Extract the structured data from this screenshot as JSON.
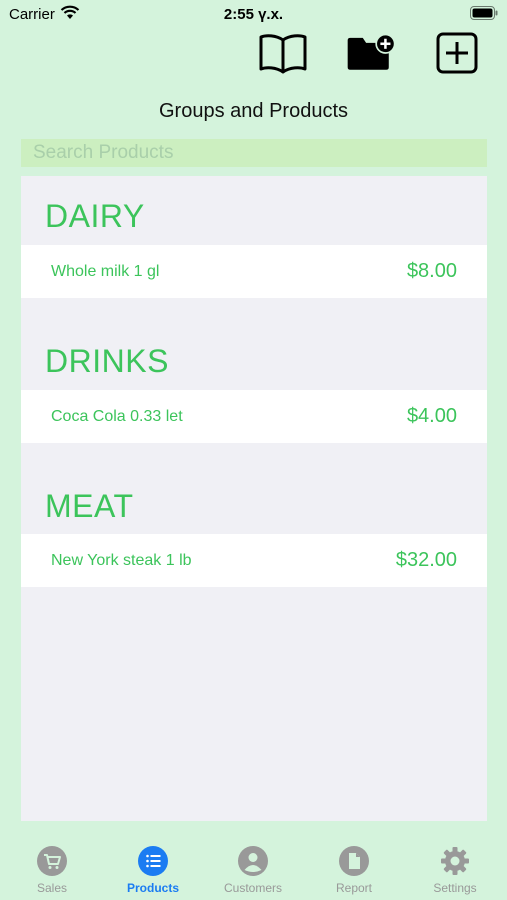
{
  "status_bar": {
    "carrier": "Carrier",
    "time": "2:55 ү.х."
  },
  "header": {
    "title": "Groups and Products"
  },
  "search": {
    "placeholder": "Search Products"
  },
  "groups": [
    {
      "name": "DAIRY",
      "products": [
        {
          "name": "Whole milk 1 gl",
          "price": "$8.00"
        }
      ]
    },
    {
      "name": "DRINKS",
      "products": [
        {
          "name": "Coca Cola 0.33 let",
          "price": "$4.00"
        }
      ]
    },
    {
      "name": "MEAT",
      "products": [
        {
          "name": "New York steak 1 lb",
          "price": "$32.00"
        }
      ]
    }
  ],
  "tabs": [
    {
      "label": "Sales",
      "icon": "cart-icon",
      "active": false
    },
    {
      "label": "Products",
      "icon": "list-icon",
      "active": true
    },
    {
      "label": "Customers",
      "icon": "person-icon",
      "active": false
    },
    {
      "label": "Report",
      "icon": "document-icon",
      "active": false
    },
    {
      "label": "Settings",
      "icon": "gear-icon",
      "active": false
    }
  ],
  "colors": {
    "background": "#d4f3dc",
    "accent": "#3cc45b",
    "active_tab": "#1b7cf2",
    "inactive_tab": "#999999"
  }
}
